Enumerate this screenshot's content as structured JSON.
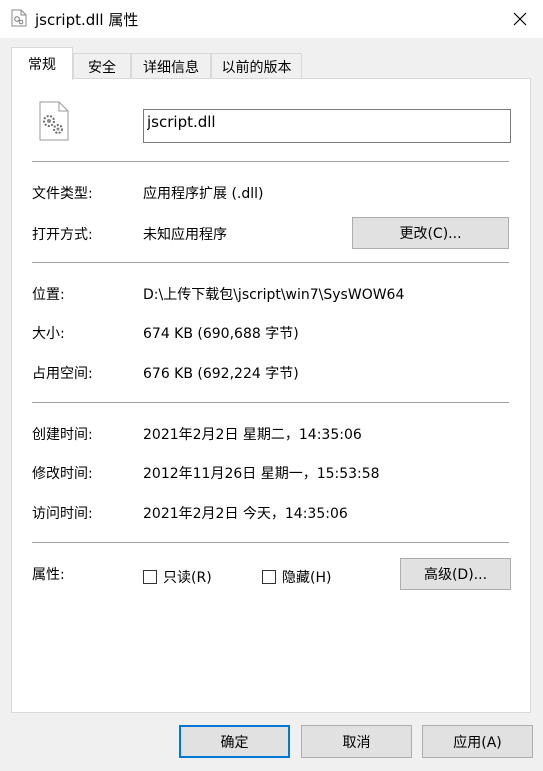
{
  "window": {
    "title": "jscript.dll 属性",
    "close_icon": "close-icon"
  },
  "tabs": [
    {
      "label": "常规",
      "active": true
    },
    {
      "label": "安全",
      "active": false
    },
    {
      "label": "详细信息",
      "active": false
    },
    {
      "label": "以前的版本",
      "active": false
    }
  ],
  "general": {
    "file_name": "jscript.dll",
    "file_type_label": "文件类型:",
    "file_type_value": "应用程序扩展 (.dll)",
    "open_with_label": "打开方式:",
    "open_with_value": "未知应用程序",
    "change_button": "更改(C)...",
    "location_label": "位置:",
    "location_value": "D:\\上传下载包\\jscript\\win7\\SysWOW64",
    "size_label": "大小:",
    "size_value": "674 KB (690,688 字节)",
    "disk_size_label": "占用空间:",
    "disk_size_value": "676 KB (692,224 字节)",
    "created_label": "创建时间:",
    "created_value": "2021年2月2日 星期二，14:35:06",
    "modified_label": "修改时间:",
    "modified_value": "2012年11月26日 星期一，15:53:58",
    "accessed_label": "访问时间:",
    "accessed_value": "2021年2月2日 今天，14:35:06",
    "attributes_label": "属性:",
    "readonly_label": "只读(R)",
    "hidden_label": "隐藏(H)",
    "advanced_button": "高级(D)..."
  },
  "footer": {
    "ok": "确定",
    "cancel": "取消",
    "apply": "应用(A)"
  }
}
